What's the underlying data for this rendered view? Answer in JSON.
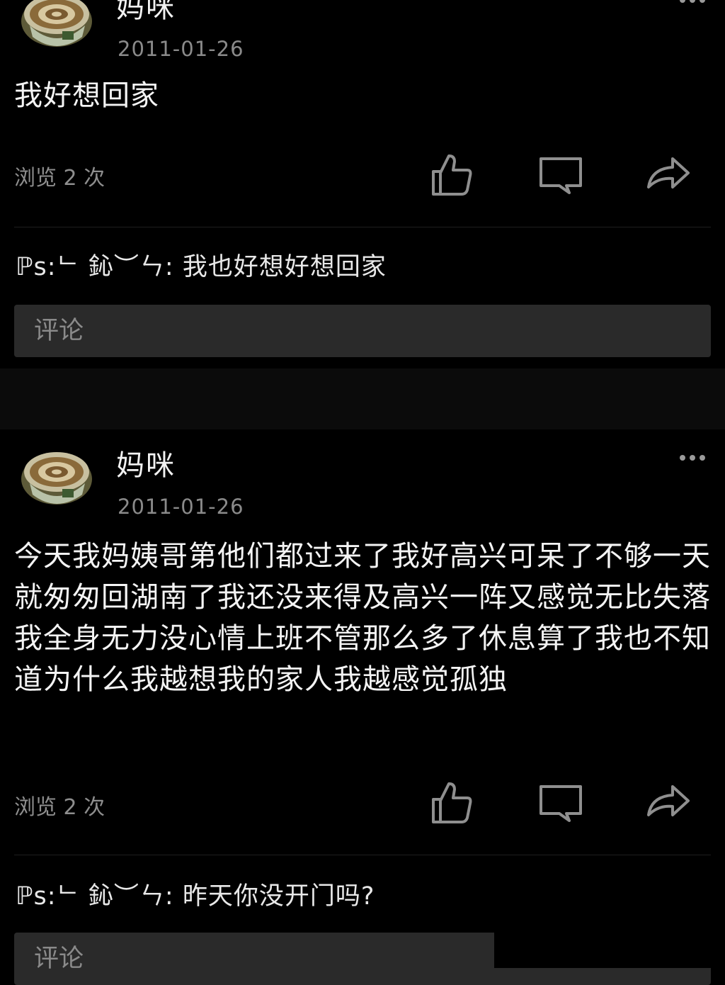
{
  "posts": [
    {
      "author": "妈咪",
      "date": "2011-01-26",
      "content": "我好想回家",
      "views": "浏览 2 次",
      "reply": {
        "name": "ℙs:ᄂ 鈊︶ㄣ",
        "separator": ":",
        "text": " 我也好想好想回家"
      },
      "comment_placeholder": "评论"
    },
    {
      "author": "妈咪",
      "date": "2011-01-26",
      "content": "今天我妈姨哥第他们都过来了我好高兴可呆了不够一天就匆匆回湖南了我还没来得及高兴一阵又感觉无比失落我全身无力没心情上班不管那么多了休息算了我也不知道为什么我越想我的家人我越感觉孤独",
      "views": "浏览 2 次",
      "reply": {
        "name": "ℙs:ᄂ 鈊︶ㄣ",
        "separator": ":",
        "text": " 昨天你没开门吗?"
      },
      "comment_placeholder": "评论"
    }
  ],
  "icons": {
    "avatar": "coffee-cup-avatar",
    "like": "thumbs-up-icon",
    "comment": "comment-bubble-icon",
    "share": "share-arrow-icon",
    "more": "more-dots-icon"
  },
  "colors": {
    "background": "#000000",
    "text": "#f4f4f4",
    "muted": "#8a8a8a",
    "input_bg": "#2a2a2a"
  }
}
